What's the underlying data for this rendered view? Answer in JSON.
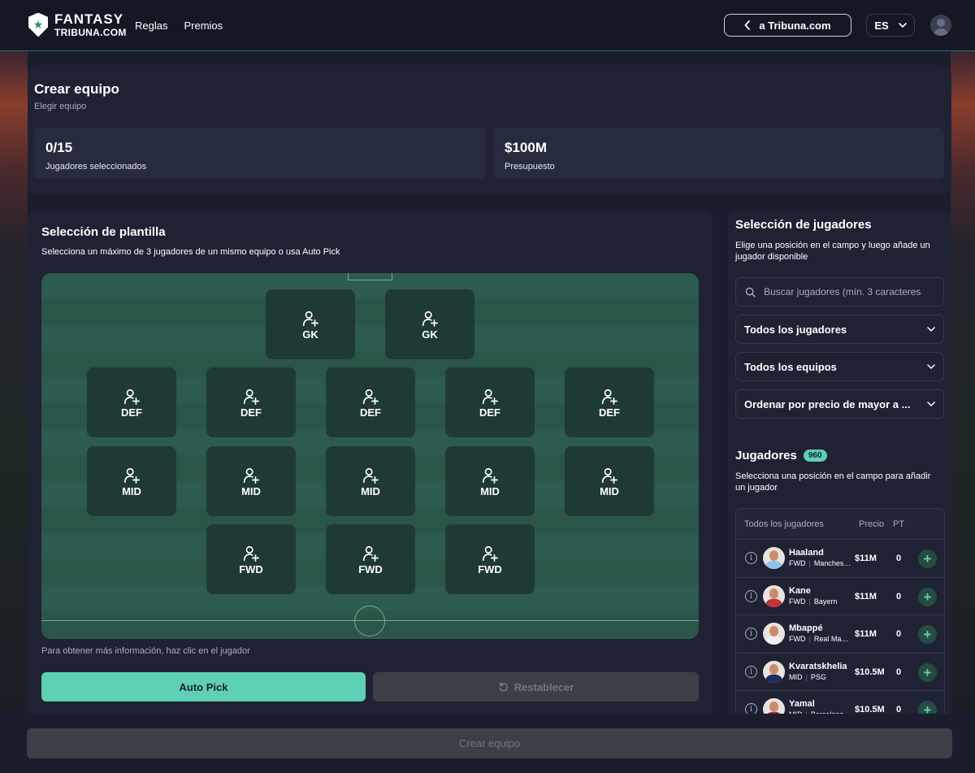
{
  "header": {
    "logo_line1": "FANTASY",
    "logo_line2": "TRIBUNA.COM",
    "nav": [
      "Reglas",
      "Premios"
    ],
    "back_link": "a Tribuna.com",
    "language": "ES"
  },
  "team": {
    "title": "Crear equipo",
    "subtitle": "Elegir equipo",
    "selected_value": "0/15",
    "selected_label": "Jugadores seleccionados",
    "budget_value": "$100M",
    "budget_label": "Presupuesto"
  },
  "squad": {
    "title": "Selección de plantilla",
    "description": "Selecciona un máximo de 3 jugadores de un mismo equipo o usa Auto Pick",
    "rows": [
      [
        "GK",
        "GK"
      ],
      [
        "DEF",
        "DEF",
        "DEF",
        "DEF",
        "DEF"
      ],
      [
        "MID",
        "MID",
        "MID",
        "MID",
        "MID"
      ],
      [
        "FWD",
        "FWD",
        "FWD"
      ]
    ],
    "hint": "Para obtener más información, haz clic en el jugador",
    "auto_pick": "Auto Pick",
    "reset": "Restablecer"
  },
  "players_panel": {
    "title": "Selección de jugadores",
    "description": "Elige una posición en el campo y luego añade un jugador disponible",
    "search_placeholder": "Buscar jugadores (mín. 3 caracteres",
    "filter_players": "Todos los jugadores",
    "filter_teams": "Todos los equipos",
    "sort": "Ordenar por precio de mayor a ...",
    "list_title": "Jugadores",
    "count": "960",
    "list_description": "Selecciona una posición en el campo para añadir un jugador",
    "columns": [
      "Todos los jugadores",
      "Precio",
      "PT"
    ],
    "players": [
      {
        "name": "Haaland",
        "pos": "FWD",
        "team": "Manchester City",
        "price": "$11M",
        "pts": "0",
        "shirt": "#8fc4e8"
      },
      {
        "name": "Kane",
        "pos": "FWD",
        "team": "Bayern",
        "price": "$11M",
        "pts": "0",
        "shirt": "#c8303a"
      },
      {
        "name": "Mbappé",
        "pos": "FWD",
        "team": "Real Madrid",
        "price": "$11M",
        "pts": "0",
        "shirt": "#f2f2f2"
      },
      {
        "name": "Kvaratskhelia",
        "pos": "MID",
        "team": "PSG",
        "price": "$10.5M",
        "pts": "0",
        "shirt": "#1e2c5a"
      },
      {
        "name": "Yamal",
        "pos": "MID",
        "team": "Barcelona",
        "price": "$10.5M",
        "pts": "0",
        "shirt": "#a52035"
      }
    ]
  },
  "footer": {
    "create_button": "Crear equipo"
  }
}
